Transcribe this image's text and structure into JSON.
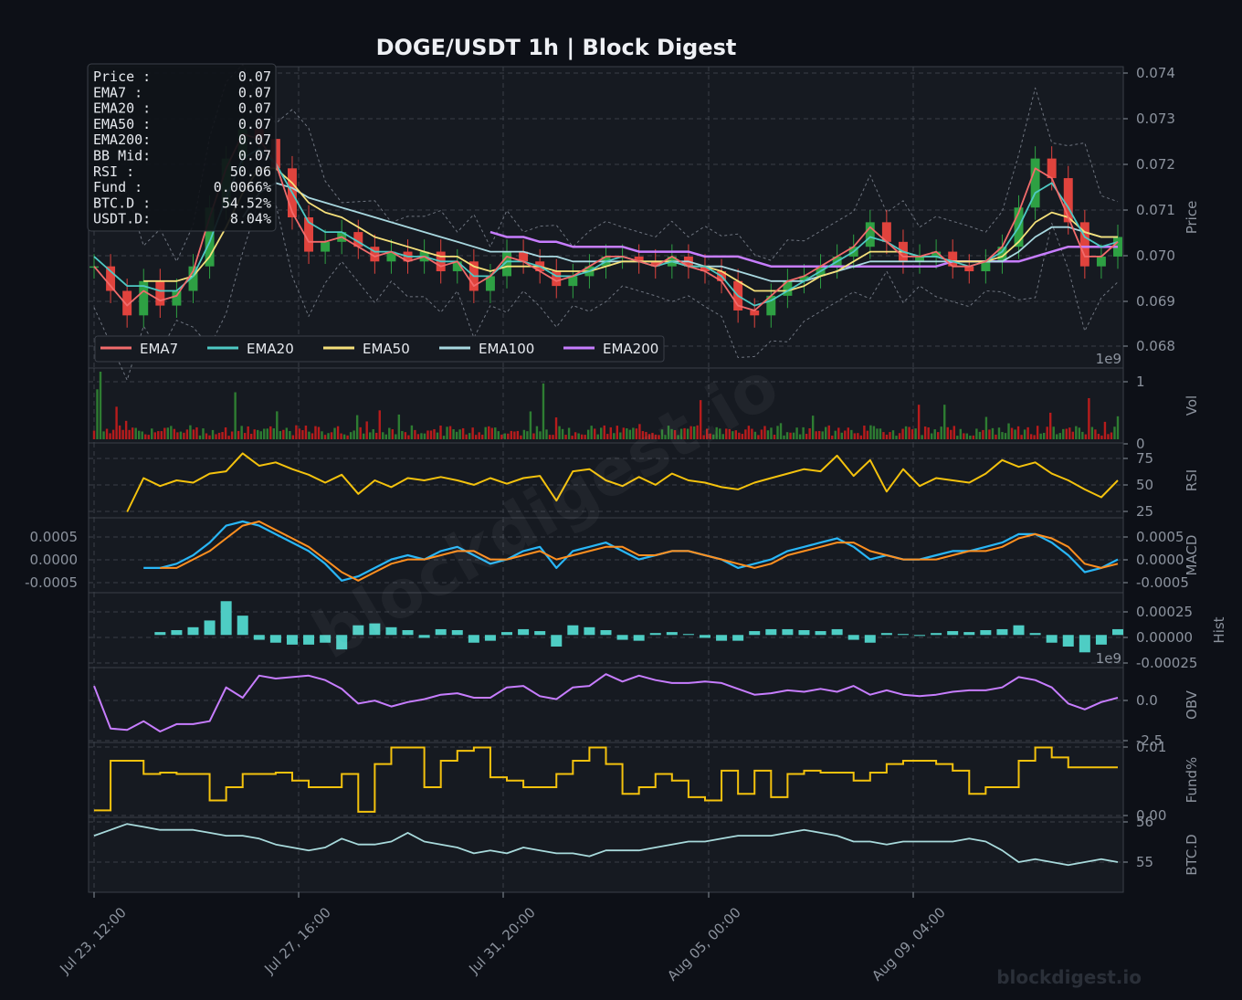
{
  "chart_data": {
    "type": "line",
    "title": "DOGE/USDT  1h  |  Block Digest",
    "x_ticks": [
      "Jul 23, 12:00",
      "Jul 27, 16:00",
      "Jul 31, 20:00",
      "Aug 05, 00:00",
      "Aug 09, 04:00"
    ],
    "info_box": [
      {
        "label": "Price :",
        "value": "0.07"
      },
      {
        "label": "EMA7  :",
        "value": "0.07"
      },
      {
        "label": "EMA20 :",
        "value": "0.07"
      },
      {
        "label": "EMA50 :",
        "value": "0.07"
      },
      {
        "label": "EMA200:",
        "value": "0.07"
      },
      {
        "label": "BB Mid:",
        "value": "0.07"
      },
      {
        "label": "RSI   :",
        "value": "50.06"
      },
      {
        "label": "Fund  :",
        "value": "0.0066%"
      },
      {
        "label": "BTC.D :",
        "value": "54.52%"
      },
      {
        "label": "USDT.D:",
        "value": "8.04%"
      }
    ],
    "legend": [
      {
        "name": "EMA7",
        "color": "#f26b6b"
      },
      {
        "name": "EMA20",
        "color": "#4ec9c4"
      },
      {
        "name": "EMA50",
        "color": "#f5e07a"
      },
      {
        "name": "EMA100",
        "color": "#a8d8e0"
      },
      {
        "name": "EMA200",
        "color": "#c77dff"
      }
    ],
    "panels": {
      "price": {
        "ylabel": "Price",
        "ylim": [
          0.068,
          0.074
        ],
        "ticks": [
          "0.068",
          "0.069",
          "0.070",
          "0.071",
          "0.072",
          "0.073",
          "0.074"
        ],
        "offset": "1e9",
        "close": [
          0.07,
          0.0695,
          0.069,
          0.0697,
          0.0692,
          0.0695,
          0.07,
          0.0712,
          0.0722,
          0.0728,
          0.0726,
          0.072,
          0.071,
          0.0703,
          0.0705,
          0.0707,
          0.0704,
          0.0701,
          0.0703,
          0.0701,
          0.0703,
          0.0699,
          0.0701,
          0.0695,
          0.0698,
          0.0703,
          0.0701,
          0.0699,
          0.0696,
          0.0698,
          0.07,
          0.0702,
          0.0702,
          0.0701,
          0.07,
          0.0702,
          0.07,
          0.0699,
          0.0697,
          0.0691,
          0.069,
          0.0694,
          0.0697,
          0.0698,
          0.07,
          0.0702,
          0.0704,
          0.0709,
          0.0705,
          0.0701,
          0.0702,
          0.0703,
          0.07,
          0.0699,
          0.0701,
          0.0704,
          0.0712,
          0.0722,
          0.0718,
          0.0709,
          0.07,
          0.0702,
          0.0706
        ]
      },
      "volume": {
        "ylabel": "Vol",
        "ylim": [
          0,
          1.15
        ],
        "ticks": [
          "0",
          "1"
        ]
      },
      "rsi": {
        "ylabel": "RSI",
        "ylim": [
          20,
          80
        ],
        "ticks": [
          "25",
          "50",
          "75"
        ]
      },
      "macd": {
        "ylabel": "MACD",
        "ylim": [
          -0.0008,
          0.0008
        ],
        "ticks": [
          "-0.0005",
          "0.0000",
          "0.0005"
        ]
      },
      "hist": {
        "ylabel": "Hist",
        "ylim": [
          -0.0003,
          0.0004
        ],
        "ticks": [
          "-0.00025",
          "0.00000",
          "0.00025"
        ],
        "offset": "1e9"
      },
      "obv": {
        "ylabel": "OBV",
        "ylim": [
          -3.0,
          1.6
        ],
        "ticks": [
          "-2.5",
          "0.0"
        ]
      },
      "fund": {
        "ylabel": "Fund%",
        "ylim": [
          0,
          0.0102
        ],
        "ticks": [
          "0.00",
          "0.01"
        ]
      },
      "btcd": {
        "ylabel": "BTC.D",
        "ylim": [
          54.0,
          56.3
        ],
        "ticks": [
          "55",
          "56"
        ]
      }
    },
    "series": [
      {
        "name": "EMA7",
        "values": [
          0.07,
          0.0696,
          0.0692,
          0.0695,
          0.0693,
          0.0694,
          0.0699,
          0.071,
          0.072,
          0.0727,
          0.0726,
          0.0721,
          0.0711,
          0.0705,
          0.0705,
          0.0706,
          0.0704,
          0.0702,
          0.0703,
          0.0701,
          0.0702,
          0.07,
          0.0701,
          0.0696,
          0.0698,
          0.0702,
          0.0701,
          0.0699,
          0.0697,
          0.0698,
          0.07,
          0.0702,
          0.0702,
          0.0701,
          0.07,
          0.0702,
          0.07,
          0.0699,
          0.0697,
          0.0692,
          0.0691,
          0.0694,
          0.0697,
          0.0698,
          0.07,
          0.0702,
          0.0704,
          0.0708,
          0.0705,
          0.0702,
          0.0702,
          0.0703,
          0.07,
          0.07,
          0.0701,
          0.0704,
          0.0711,
          0.072,
          0.0718,
          0.071,
          0.0702,
          0.0702,
          0.0705
        ]
      },
      {
        "name": "EMA20",
        "values": [
          0.0702,
          0.0699,
          0.0696,
          0.0696,
          0.0695,
          0.0695,
          0.0698,
          0.0705,
          0.0714,
          0.0722,
          0.0724,
          0.0721,
          0.0715,
          0.0709,
          0.0707,
          0.0707,
          0.0705,
          0.0703,
          0.0703,
          0.0702,
          0.0702,
          0.0701,
          0.0701,
          0.0698,
          0.0698,
          0.0701,
          0.0701,
          0.07,
          0.0698,
          0.0698,
          0.0699,
          0.0701,
          0.0702,
          0.0701,
          0.07,
          0.0701,
          0.07,
          0.07,
          0.0698,
          0.0694,
          0.0692,
          0.0693,
          0.0695,
          0.0697,
          0.0699,
          0.0701,
          0.0703,
          0.0706,
          0.0705,
          0.0703,
          0.0702,
          0.0702,
          0.0701,
          0.07,
          0.0701,
          0.0703,
          0.0708,
          0.0715,
          0.0717,
          0.0712,
          0.0706,
          0.0704,
          0.0705
        ]
      },
      {
        "name": "EMA50",
        "values": [
          null,
          null,
          null,
          0.0697,
          0.0697,
          0.0697,
          0.0698,
          0.0702,
          0.0708,
          0.0715,
          0.072,
          0.072,
          0.0717,
          0.0713,
          0.0711,
          0.071,
          0.0708,
          0.0706,
          0.0705,
          0.0704,
          0.0703,
          0.0702,
          0.0702,
          0.07,
          0.0699,
          0.07,
          0.07,
          0.07,
          0.0699,
          0.0699,
          0.0699,
          0.07,
          0.0701,
          0.0701,
          0.0701,
          0.0701,
          0.07,
          0.07,
          0.0699,
          0.0697,
          0.0695,
          0.0695,
          0.0695,
          0.0696,
          0.0698,
          0.0699,
          0.0701,
          0.0703,
          0.0703,
          0.0703,
          0.0702,
          0.0702,
          0.0701,
          0.0701,
          0.0701,
          0.0702,
          0.0705,
          0.0709,
          0.0711,
          0.071,
          0.0707,
          0.0706,
          0.0706
        ]
      },
      {
        "name": "EMA100",
        "values": [
          null,
          null,
          null,
          null,
          null,
          null,
          null,
          null,
          null,
          0.071,
          0.0715,
          0.0717,
          0.0716,
          0.0714,
          0.0713,
          0.0712,
          0.0711,
          0.071,
          0.0709,
          0.0708,
          0.0707,
          0.0706,
          0.0705,
          0.0704,
          0.0703,
          0.0703,
          0.0703,
          0.0702,
          0.0702,
          0.0701,
          0.0701,
          0.0701,
          0.0701,
          0.0701,
          0.0701,
          0.0701,
          0.0701,
          0.07,
          0.07,
          0.0699,
          0.0698,
          0.0697,
          0.0697,
          0.0697,
          0.0698,
          0.0699,
          0.07,
          0.0701,
          0.0701,
          0.0701,
          0.0701,
          0.0701,
          0.0701,
          0.0701,
          0.0701,
          0.0701,
          0.0703,
          0.0706,
          0.0708,
          0.0708,
          0.0707,
          0.0706,
          0.0706
        ]
      },
      {
        "name": "EMA200",
        "values": [
          null,
          null,
          null,
          null,
          null,
          null,
          null,
          null,
          null,
          null,
          null,
          null,
          null,
          null,
          null,
          null,
          null,
          null,
          null,
          null,
          null,
          null,
          null,
          null,
          0.0707,
          0.0706,
          0.0706,
          0.0705,
          0.0705,
          0.0704,
          0.0704,
          0.0704,
          0.0704,
          0.0703,
          0.0703,
          0.0703,
          0.0703,
          0.0702,
          0.0702,
          0.0702,
          0.0701,
          0.07,
          0.07,
          0.07,
          0.07,
          0.07,
          0.07,
          0.07,
          0.07,
          0.07,
          0.07,
          0.07,
          0.0701,
          0.0701,
          0.0701,
          0.0701,
          0.0701,
          0.0702,
          0.0703,
          0.0704,
          0.0704,
          0.0704,
          0.0704
        ]
      },
      {
        "name": "RSI",
        "values": [
          null,
          null,
          22,
          52,
          45,
          50,
          48,
          56,
          58,
          74,
          63,
          66,
          60,
          55,
          48,
          55,
          38,
          50,
          44,
          52,
          50,
          53,
          50,
          46,
          52,
          47,
          52,
          54,
          32,
          58,
          60,
          50,
          45,
          53,
          46,
          56,
          50,
          48,
          44,
          42,
          48,
          52,
          56,
          60,
          58,
          72,
          54,
          68,
          40,
          60,
          45,
          52,
          50,
          48,
          56,
          68,
          62,
          66,
          56,
          50,
          42,
          35,
          50
        ]
      },
      {
        "name": "MACD",
        "values": [
          null,
          null,
          null,
          -0.0003,
          -0.0003,
          -0.0002,
          0.0,
          0.0003,
          0.0007,
          0.0008,
          0.0007,
          0.0005,
          0.0003,
          0.0001,
          -0.0002,
          -0.0006,
          -0.0005,
          -0.0003,
          -0.0001,
          0.0,
          -0.0001,
          0.0001,
          0.0002,
          0.0,
          -0.0002,
          -0.0001,
          0.0001,
          0.0002,
          -0.0003,
          0.0001,
          0.0002,
          0.0003,
          0.0001,
          -0.0001,
          0.0,
          0.0001,
          0.0001,
          0.0,
          -0.0001,
          -0.0003,
          -0.0002,
          -0.0001,
          0.0001,
          0.0002,
          0.0003,
          0.0004,
          0.0002,
          -0.0001,
          0.0,
          -0.0001,
          -0.0001,
          0.0,
          0.0001,
          0.0001,
          0.0002,
          0.0003,
          0.0005,
          0.0005,
          0.0003,
          0.0,
          -0.0004,
          -0.0003,
          -0.0001
        ]
      },
      {
        "name": "Signal",
        "values": [
          null,
          null,
          null,
          null,
          -0.0003,
          -0.0003,
          -0.0001,
          0.0001,
          0.0004,
          0.0007,
          0.0008,
          0.0006,
          0.0004,
          0.0002,
          -0.0001,
          -0.0004,
          -0.0006,
          -0.0004,
          -0.0002,
          -0.0001,
          -0.0001,
          0.0,
          0.0001,
          0.0001,
          -0.0001,
          -0.0001,
          0.0,
          0.0001,
          -0.0001,
          0.0,
          0.0001,
          0.0002,
          0.0002,
          0.0,
          0.0,
          0.0001,
          0.0001,
          0.0,
          -0.0001,
          -0.0002,
          -0.0003,
          -0.0002,
          0.0,
          0.0001,
          0.0002,
          0.0003,
          0.0003,
          0.0001,
          0.0,
          -0.0001,
          -0.0001,
          -0.0001,
          0.0,
          0.0001,
          0.0001,
          0.0002,
          0.0004,
          0.0005,
          0.0004,
          0.0002,
          -0.0002,
          -0.0003,
          -0.0002
        ]
      },
      {
        "name": "Hist",
        "values": [
          null,
          null,
          null,
          null,
          3e-05,
          5e-05,
          8e-05,
          0.00015,
          0.00035,
          0.0002,
          -5e-05,
          -8e-05,
          -0.0001,
          -0.0001,
          -8e-05,
          -0.00015,
          0.0001,
          0.00012,
          8e-05,
          5e-05,
          -3e-05,
          6e-05,
          5e-05,
          -8e-05,
          -6e-05,
          3e-05,
          6e-05,
          4e-05,
          -0.00012,
          0.0001,
          8e-05,
          5e-05,
          -5e-05,
          -6e-05,
          2e-05,
          3e-05,
          1e-05,
          -3e-05,
          -6e-05,
          -6e-05,
          4e-05,
          6e-05,
          6e-05,
          5e-05,
          4e-05,
          6e-05,
          -5e-05,
          -8e-05,
          2e-05,
          1e-05,
          -1e-05,
          2e-05,
          4e-05,
          3e-05,
          5e-05,
          6e-05,
          0.0001,
          2e-05,
          -8e-05,
          -0.00012,
          -0.00018,
          -0.0001,
          6e-05
        ]
      },
      {
        "name": "OBV",
        "values": [
          0.6,
          -2.3,
          -2.4,
          -1.8,
          -2.5,
          -2.0,
          -2.0,
          -1.8,
          0.5,
          -0.2,
          1.3,
          1.1,
          1.2,
          1.3,
          1.0,
          0.4,
          -0.6,
          -0.4,
          -0.8,
          -0.5,
          -0.3,
          0.0,
          0.1,
          -0.2,
          -0.2,
          0.5,
          0.6,
          -0.1,
          -0.3,
          0.5,
          0.6,
          1.4,
          0.9,
          1.3,
          1.0,
          0.8,
          0.8,
          0.9,
          0.8,
          0.4,
          0.0,
          0.1,
          0.3,
          0.2,
          0.4,
          0.2,
          0.6,
          0.0,
          0.3,
          0.0,
          -0.1,
          0.0,
          0.2,
          0.3,
          0.3,
          0.5,
          1.2,
          1.0,
          0.5,
          -0.6,
          -1.0,
          -0.5,
          -0.2
        ]
      },
      {
        "name": "Fund%",
        "values": [
          0.0005,
          0.008,
          0.008,
          0.006,
          0.0062,
          0.006,
          0.006,
          0.002,
          0.004,
          0.006,
          0.006,
          0.0062,
          0.005,
          0.004,
          0.004,
          0.006,
          0.0003,
          0.0075,
          0.01,
          0.01,
          0.004,
          0.008,
          0.0095,
          0.01,
          0.0055,
          0.005,
          0.004,
          0.004,
          0.006,
          0.008,
          0.01,
          0.0075,
          0.003,
          0.004,
          0.006,
          0.005,
          0.0025,
          0.002,
          0.0065,
          0.003,
          0.0065,
          0.0025,
          0.006,
          0.0065,
          0.0062,
          0.0062,
          0.005,
          0.0062,
          0.0075,
          0.008,
          0.008,
          0.0075,
          0.0065,
          0.003,
          0.004,
          0.004,
          0.008,
          0.01,
          0.0085,
          0.007,
          0.007,
          0.007,
          0.007
        ]
      },
      {
        "name": "BTC.D",
        "values": [
          55.8,
          56.0,
          56.2,
          56.1,
          56.0,
          56.0,
          56.0,
          55.9,
          55.8,
          55.8,
          55.7,
          55.5,
          55.4,
          55.3,
          55.4,
          55.7,
          55.5,
          55.5,
          55.6,
          55.9,
          55.6,
          55.5,
          55.4,
          55.2,
          55.3,
          55.2,
          55.4,
          55.3,
          55.2,
          55.2,
          55.1,
          55.3,
          55.3,
          55.3,
          55.4,
          55.5,
          55.6,
          55.6,
          55.7,
          55.8,
          55.8,
          55.8,
          55.9,
          56.0,
          55.9,
          55.8,
          55.6,
          55.6,
          55.5,
          55.6,
          55.6,
          55.6,
          55.6,
          55.7,
          55.6,
          55.3,
          54.9,
          55.0,
          54.9,
          54.8,
          54.9,
          55.0,
          54.9
        ]
      }
    ]
  }
}
